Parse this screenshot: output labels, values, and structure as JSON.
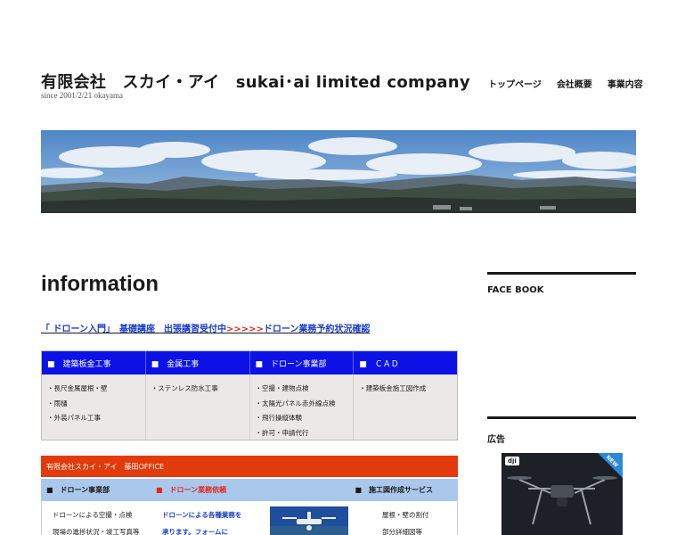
{
  "header": {
    "title": "有限会社　スカイ・アイ　sukai･ai limited company",
    "tagline": "since 2001/2/21 okayama",
    "nav": [
      "トップページ",
      "会社概要",
      "事業内容"
    ]
  },
  "main": {
    "heading": "information",
    "notice": {
      "part1": "「 ドローン入門」　基礎講座　出張講習受付中",
      "arrows": ">>>>>",
      "part2": "ドローン業務予約状況確認"
    },
    "services": {
      "headers": [
        "■　建築板金工事",
        "■　金属工事",
        "■　ドローン事業部",
        "■　ＣＡＤ"
      ],
      "columns": [
        [
          "・長尺金属屋根・壁",
          "・雨樋",
          "・外装パネル工事"
        ],
        [
          "・ステンレス防水工事"
        ],
        [
          "・空撮・建物点検",
          "・太陽光パネル赤外線点検",
          "・飛行操縦体験",
          "・許可・申請代行"
        ],
        [
          "・建築板金施工図作成"
        ]
      ]
    },
    "office": {
      "title": "有限会社スカイ・アイ　藤田OFFICE",
      "subheaders": [
        "■　ドローン事業部",
        "■　ドローン業務依頼",
        "■　施工図作成サービス"
      ],
      "col1": [
        "ドローンによる空撮・点検",
        "現場の進捗状況・竣工写真等"
      ],
      "col2": [
        "ドローンによる各種業務を",
        "承ります。フォームに"
      ],
      "col3": [
        "屋根・壁の割付",
        "部分詳細図等"
      ]
    }
  },
  "sidebar": {
    "facebook_heading": "FACE BOOK",
    "ad_heading": "広告",
    "ad_logo": "dji",
    "ad_badge": "NEW"
  }
}
